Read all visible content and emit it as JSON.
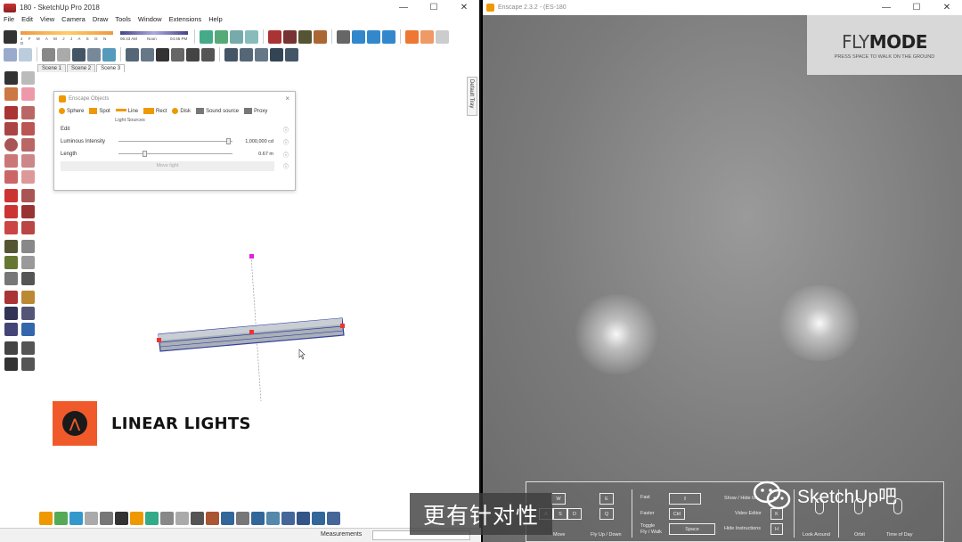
{
  "sketchup": {
    "title": "180 - SketchUp Pro 2018",
    "window_controls": [
      "—",
      "☐",
      "✕"
    ],
    "menu": [
      "File",
      "Edit",
      "View",
      "Camera",
      "Draw",
      "Tools",
      "Window",
      "Extensions",
      "Help"
    ],
    "shadow_months": "J F M A M J J A S O N D",
    "shadow_times": [
      "06:43 AM",
      "Noon",
      "04:45 PM"
    ],
    "scene_tabs": [
      "Scene 1",
      "Scene 2",
      "Scene 3"
    ],
    "active_scene": "Scene 3",
    "tray_label": "Default Tray",
    "status": {
      "measurements_label": "Measurements"
    }
  },
  "enscape_objects": {
    "title": "Enscape Objects",
    "close": "×",
    "types": [
      "Sphere",
      "Spot",
      "Line",
      "Rect",
      "Disk",
      "Sound source",
      "Proxy"
    ],
    "caption": "Light Sources",
    "rows": [
      {
        "label": "Edit",
        "value": ""
      },
      {
        "label": "Luminous Intensity",
        "value": "1,000,000 cd",
        "level": 0.98
      },
      {
        "label": "Length",
        "value": "0.67 m",
        "level": 0.22
      }
    ],
    "info_glyph": "ⓘ",
    "move_button": "Move light"
  },
  "badge": {
    "text": "LINEAR LIGHTS",
    "icon": "enscape-logo-icon"
  },
  "enscape": {
    "title": "Enscape 2.3.2 - (ES-180",
    "flymode_a": "FLY",
    "flymode_b": "MODE",
    "flymode_sub": "PRESS SPACE TO WALK ON THE GROUND",
    "hud": {
      "keys_move": [
        "W",
        "A",
        "S",
        "D"
      ],
      "keys_fly": [
        "E",
        "Q"
      ],
      "move": "Move",
      "fly": "Fly Up / Down",
      "fast": "Fast",
      "faster": "Faster",
      "toggle": "Toggle\nFly / Walk",
      "shift": "⇧",
      "ctrl": "Ctrl",
      "space": "Space",
      "show_hide": "Show / Hide to",
      "video_editor": "Video Editor",
      "hide_instructions": "Hide Instructions",
      "k1": "K",
      "k2": "R",
      "k3": "H",
      "look": "Look Around",
      "orbit": "Orbit",
      "time": "Time of Day"
    }
  },
  "overlay": {
    "subtitle": "更有针对性",
    "watermark": "SketchUp吧"
  }
}
